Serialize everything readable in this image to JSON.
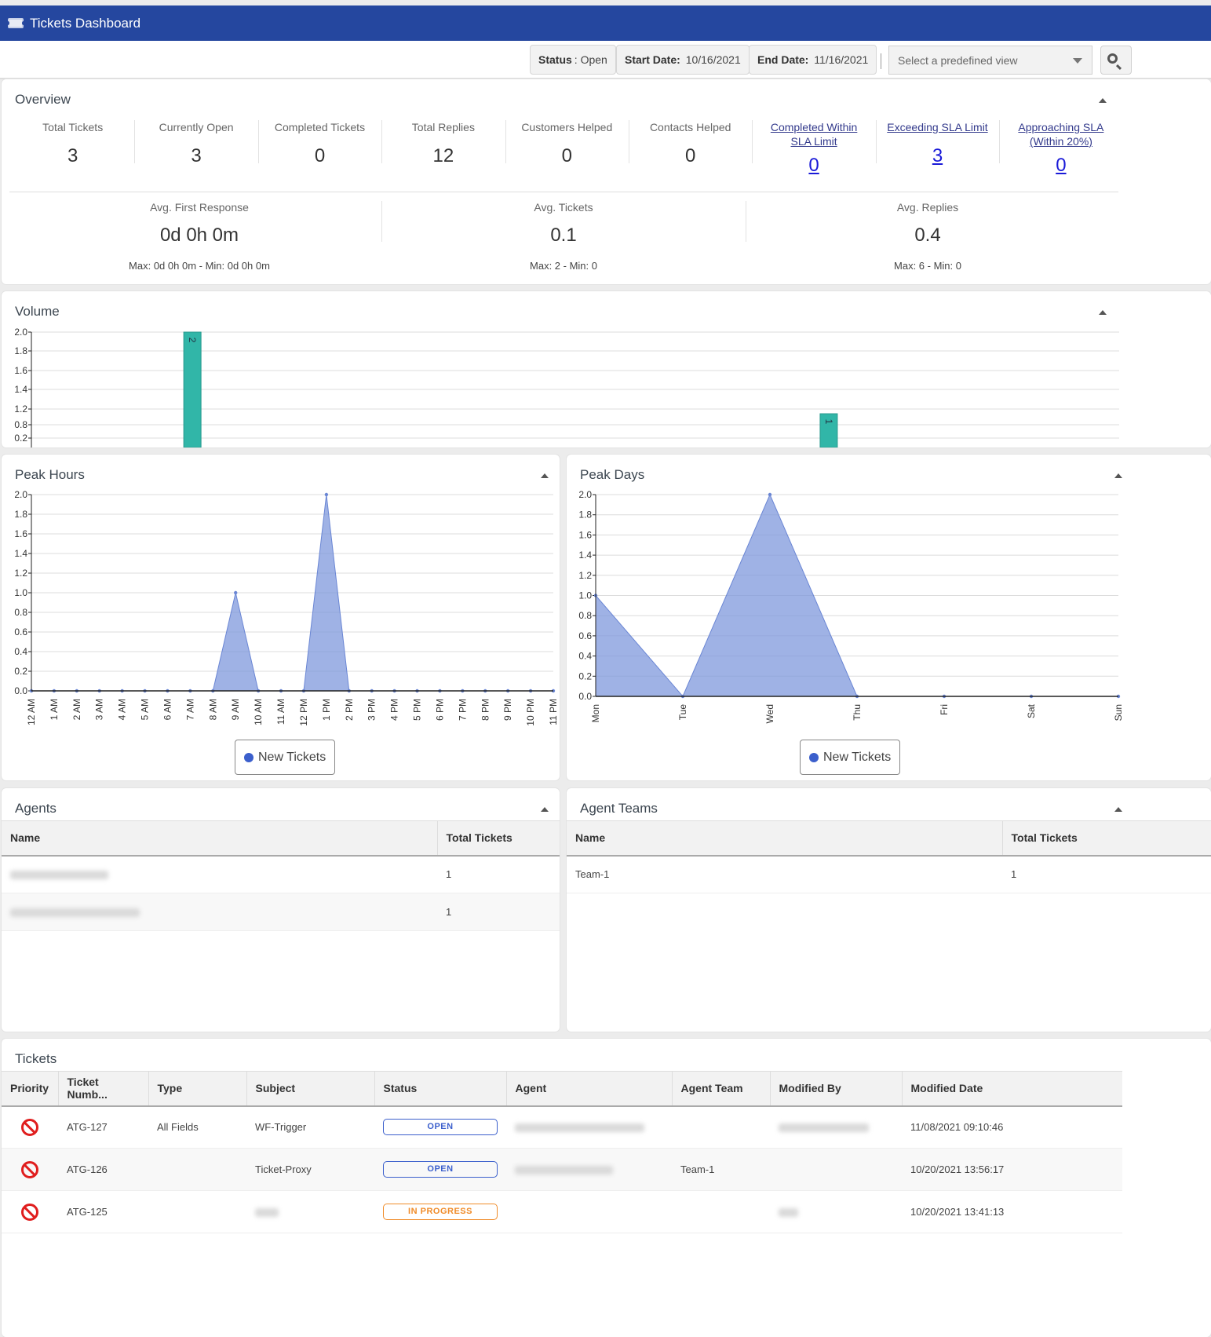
{
  "header": {
    "title": "Tickets Dashboard",
    "icon": "ticket-icon"
  },
  "filters": {
    "status_label": "Status",
    "status_value": "Open",
    "start_label": "Start Date:",
    "start_value": "10/16/2021",
    "end_label": "End Date:",
    "end_value": "11/16/2021",
    "view_placeholder": "Select a predefined view",
    "search_icon": "search-icon"
  },
  "overview": {
    "title": "Overview",
    "stats": [
      {
        "label": "Total Tickets",
        "value": "3",
        "link": false
      },
      {
        "label": "Currently Open",
        "value": "3",
        "link": false
      },
      {
        "label": "Completed Tickets",
        "value": "0",
        "link": false
      },
      {
        "label": "Total Replies",
        "value": "12",
        "link": false
      },
      {
        "label": "Customers Helped",
        "value": "0",
        "link": false
      },
      {
        "label": "Contacts Helped",
        "value": "0",
        "link": false
      },
      {
        "label": "Completed Within SLA Limit",
        "value": "0",
        "link": true
      },
      {
        "label": "Exceeding SLA Limit",
        "value": "3",
        "link": true
      },
      {
        "label": "Approaching SLA (Within 20%)",
        "value": "0",
        "link": true
      }
    ],
    "averages": [
      {
        "label": "Avg. First Response",
        "value": "0d 0h 0m",
        "sub": "Max: 0d 0h 0m - Min: 0d 0h 0m"
      },
      {
        "label": "Avg. Tickets",
        "value": "0.1",
        "sub": "Max: 2 - Min: 0"
      },
      {
        "label": "Avg. Replies",
        "value": "0.4",
        "sub": "Max: 6 - Min: 0"
      }
    ]
  },
  "volume": {
    "title": "Volume"
  },
  "peak_hours": {
    "title": "Peak Hours",
    "legend": "New Tickets"
  },
  "peak_days": {
    "title": "Peak Days",
    "legend": "New Tickets"
  },
  "agents": {
    "title": "Agents",
    "columns": [
      "Name",
      "Total Tickets"
    ],
    "rows": [
      {
        "name": "",
        "total": "1"
      },
      {
        "name": "",
        "total": "1"
      }
    ]
  },
  "agent_teams": {
    "title": "Agent Teams",
    "columns": [
      "Name",
      "Total Tickets"
    ],
    "rows": [
      {
        "name": "Team-1",
        "total": "1"
      }
    ]
  },
  "tickets": {
    "title": "Tickets",
    "columns": [
      "Priority",
      "Ticket Numb...",
      "Type",
      "Subject",
      "Status",
      "Agent",
      "Agent Team",
      "Modified By",
      "Modified Date"
    ],
    "rows": [
      {
        "priority_icon": "no-entry-icon",
        "number": "ATG-127",
        "type": "All Fields",
        "subject": "WF-Trigger",
        "status": "OPEN",
        "agent_team": "",
        "modified_date": "11/08/2021 09:10:46"
      },
      {
        "priority_icon": "no-entry-icon",
        "number": "ATG-126",
        "type": "",
        "subject": "Ticket-Proxy",
        "status": "OPEN",
        "agent_team": "Team-1",
        "modified_date": "10/20/2021 13:56:17"
      },
      {
        "priority_icon": "no-entry-icon",
        "number": "ATG-125",
        "type": "",
        "subject": "",
        "status": "IN PROGRESS",
        "agent_team": "",
        "modified_date": "10/20/2021 13:41:13"
      }
    ]
  },
  "colors": {
    "header": "#25479f",
    "bar": "#31b6a8",
    "area": "#7f98dc",
    "open": "#3b5fcc",
    "in_progress": "#f08c2a",
    "link": "#1a1ad8"
  },
  "chart_data": [
    {
      "type": "bar",
      "title": "Volume",
      "yticks": [
        "2.0",
        "1.8",
        "1.6",
        "1.4",
        "1.2",
        "0.8",
        "0.2"
      ],
      "ylim": [
        0,
        2
      ],
      "bars": [
        {
          "position": 0.148,
          "value": 2,
          "label": "2"
        },
        {
          "position": 0.733,
          "value": 1,
          "label": "1"
        }
      ],
      "xlabel": "",
      "ylabel": ""
    },
    {
      "type": "area",
      "title": "Peak Hours",
      "categories": [
        "12 AM",
        "1 AM",
        "2 AM",
        "3 AM",
        "4 AM",
        "5 AM",
        "6 AM",
        "7 AM",
        "8 AM",
        "9 AM",
        "10 AM",
        "11 AM",
        "12 PM",
        "1 PM",
        "2 PM",
        "3 PM",
        "4 PM",
        "5 PM",
        "6 PM",
        "7 PM",
        "8 PM",
        "9 PM",
        "10 PM",
        "11 PM"
      ],
      "series": [
        {
          "name": "New Tickets",
          "values": [
            0,
            0,
            0,
            0,
            0,
            0,
            0,
            0,
            0,
            1,
            0,
            0,
            0,
            2,
            0,
            0,
            0,
            0,
            0,
            0,
            0,
            0,
            0,
            0
          ]
        }
      ],
      "yticks": [
        "0.0",
        "0.2",
        "0.4",
        "0.6",
        "0.8",
        "1.0",
        "1.2",
        "1.4",
        "1.6",
        "1.8",
        "2.0"
      ],
      "ylim": [
        0,
        2
      ],
      "grid": true,
      "legend": "bottom-center"
    },
    {
      "type": "area",
      "title": "Peak Days",
      "categories": [
        "Mon",
        "Tue",
        "Wed",
        "Thu",
        "Fri",
        "Sat",
        "Sun"
      ],
      "series": [
        {
          "name": "New Tickets",
          "values": [
            1,
            0,
            2,
            0,
            0,
            0,
            0
          ]
        }
      ],
      "yticks": [
        "0.0",
        "0.2",
        "0.4",
        "0.6",
        "0.8",
        "1.0",
        "1.2",
        "1.4",
        "1.6",
        "1.8",
        "2.0"
      ],
      "ylim": [
        0,
        2
      ],
      "grid": true,
      "legend": "bottom-center"
    }
  ]
}
